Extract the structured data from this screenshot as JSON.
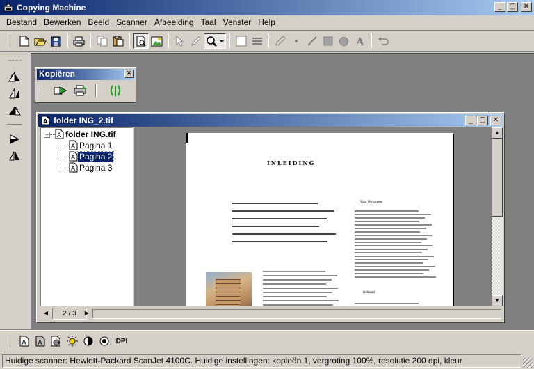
{
  "app": {
    "title": "Copying Machine"
  },
  "window_buttons": {
    "minimize": "_",
    "maximize": "□",
    "close": "✕"
  },
  "menu": [
    {
      "label": "Bestand",
      "key": "B",
      "rest": "estand"
    },
    {
      "label": "Bewerken",
      "key": "B",
      "rest": "ewerken"
    },
    {
      "label": "Beeld",
      "key": "B",
      "rest": "eeld"
    },
    {
      "label": "Scanner",
      "key": "S",
      "rest": "canner"
    },
    {
      "label": "Afbeelding",
      "key": "A",
      "rest": "fbeelding"
    },
    {
      "label": "Taal",
      "key": "T",
      "rest": "aal"
    },
    {
      "label": "Venster",
      "key": "V",
      "rest": "enster"
    },
    {
      "label": "Help",
      "key": "H",
      "rest": "elp"
    }
  ],
  "toolbar_icons": [
    "new-icon",
    "open-icon",
    "save-icon",
    "print-icon",
    "copy-icon",
    "paste-icon",
    "page-view-icon",
    "image-icon",
    "pointer-icon",
    "pen-icon",
    "zoom-icon",
    "rectangle-select-icon",
    "lines-icon",
    "pencil-icon",
    "dot-icon",
    "line-icon",
    "filled-rect-icon",
    "filled-circle-icon",
    "text-icon",
    "undo-icon"
  ],
  "kopieren_panel": {
    "title": "Kopiëren",
    "close": "✕",
    "toggle_label": "⟨|⟩"
  },
  "document": {
    "title": "folder ING_2.tif",
    "tree": {
      "root": "folder ING.tif",
      "pages": [
        "Pagina 1",
        "Pagina 2",
        "Pagina 3"
      ],
      "selected_index": 1,
      "expander": "−"
    },
    "page_heading": "INLEIDING",
    "side_heading": "Van Beusten",
    "side_heading2": "Inhoud",
    "pager": {
      "current": "2 / 3",
      "prev": "◀",
      "next": "▶"
    },
    "scroll": {
      "up": "▲",
      "down": "▼"
    }
  },
  "bottom_toolbar": {
    "dpi_label": "DPI"
  },
  "status": {
    "text": "Huidige scanner: Hewlett-Packard ScanJet 4100C. Huidige instellingen: kopieën 1, vergroting 100%, resolutie 200 dpi, kleur"
  }
}
